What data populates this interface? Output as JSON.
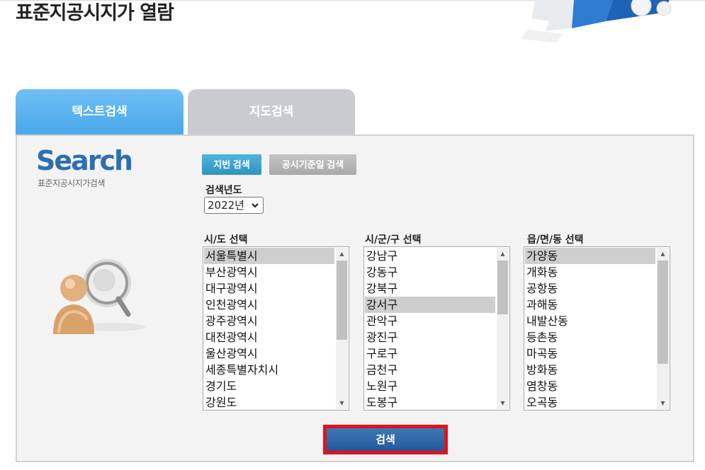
{
  "page": {
    "title": "표준지공시지가 열람"
  },
  "tabs": [
    {
      "label": "텍스트검색",
      "active": true
    },
    {
      "label": "지도검색",
      "active": false
    }
  ],
  "logo": {
    "word": "Search",
    "subtitle": "표준지공시지가검색"
  },
  "search_type": {
    "jibun_label": "지번 검색",
    "date_label": "공시기준일 검색"
  },
  "year": {
    "label": "검색년도",
    "value": "2022년"
  },
  "sido": {
    "label": "시/도 선택",
    "items": [
      "서울특별시",
      "부산광역시",
      "대구광역시",
      "인천광역시",
      "광주광역시",
      "대전광역시",
      "울산광역시",
      "세종특별자치시",
      "경기도",
      "강원도"
    ],
    "selected": "서울특별시"
  },
  "sigungu": {
    "label": "시/군/구 선택",
    "items": [
      "강남구",
      "강동구",
      "강북구",
      "강서구",
      "관악구",
      "광진구",
      "구로구",
      "금천구",
      "노원구",
      "도봉구"
    ],
    "selected": "강서구"
  },
  "eupmyeondong": {
    "label": "읍/면/동 선택",
    "items": [
      "가양동",
      "개화동",
      "공항동",
      "과해동",
      "내발산동",
      "등촌동",
      "마곡동",
      "방화동",
      "염창동",
      "오곡동"
    ],
    "selected": "가양동"
  },
  "search_button": {
    "label": "검색"
  },
  "icons": {
    "scroll_up": "scroll-up-icon",
    "scroll_down": "scroll-down-icon",
    "dropdown": "chevron-down-icon"
  }
}
